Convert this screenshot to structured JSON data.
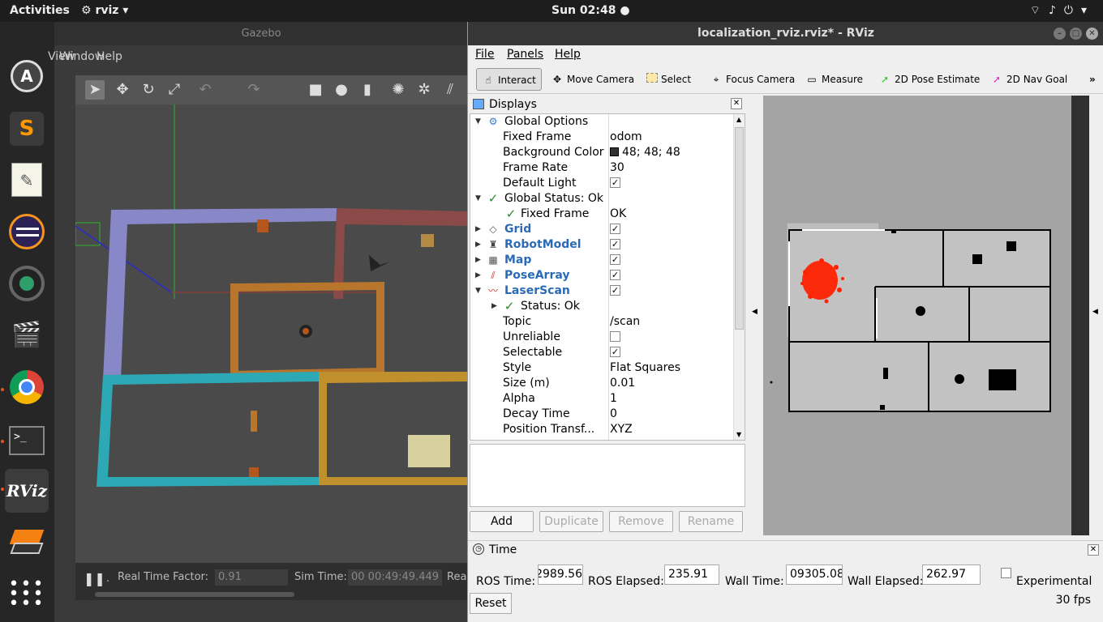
{
  "topbar": {
    "activities": "Activities",
    "app_menu": "rviz",
    "clock": "Sun 02:48"
  },
  "dock": {
    "items": [
      "ubuntu-software-icon",
      "sublime-text-icon",
      "text-editor-icon",
      "eclipse-icon",
      "camera-icon",
      "video-icon",
      "chrome-icon",
      "terminal-icon",
      "rviz-icon",
      "gazebo-icon",
      "app-grid-icon"
    ],
    "rviz_label": "RViz"
  },
  "gazebo": {
    "title": "Gazebo",
    "menu": {
      "view": "View",
      "window": "Window",
      "help": "Help"
    },
    "bottom": {
      "real_time_factor_label": "Real Time Factor:",
      "real_time_factor": "0.91",
      "sim_time_label": "Sim Time:",
      "sim_time": "00 00:49:49.449",
      "real_time_label": "Rea"
    }
  },
  "rviz": {
    "title": "localization_rviz.rviz* - RViz",
    "menu": {
      "file": "File",
      "panels": "Panels",
      "help": "Help"
    },
    "tools": {
      "interact": "Interact",
      "move_camera": "Move Camera",
      "select": "Select",
      "focus_camera": "Focus Camera",
      "measure": "Measure",
      "pose_estimate": "2D Pose Estimate",
      "nav_goal": "2D Nav Goal",
      "more": "»"
    },
    "displays": {
      "header": "Displays",
      "rows": [
        {
          "key": "Global Options",
          "value": ""
        },
        {
          "key": "Fixed Frame",
          "value": "odom"
        },
        {
          "key": "Background Color",
          "value": "48; 48; 48"
        },
        {
          "key": "Frame Rate",
          "value": "30"
        },
        {
          "key": "Default Light",
          "value": "✓"
        },
        {
          "key": "Global Status: Ok",
          "value": ""
        },
        {
          "key": "Fixed Frame",
          "value": "OK"
        },
        {
          "key": "Grid",
          "value": "✓"
        },
        {
          "key": "RobotModel",
          "value": "✓"
        },
        {
          "key": "Map",
          "value": "✓"
        },
        {
          "key": "PoseArray",
          "value": "✓"
        },
        {
          "key": "LaserScan",
          "value": "✓"
        },
        {
          "key": "Status: Ok",
          "value": ""
        },
        {
          "key": "Topic",
          "value": "/scan"
        },
        {
          "key": "Unreliable",
          "value": ""
        },
        {
          "key": "Selectable",
          "value": "✓"
        },
        {
          "key": "Style",
          "value": "Flat Squares"
        },
        {
          "key": "Size (m)",
          "value": "0.01"
        },
        {
          "key": "Alpha",
          "value": "1"
        },
        {
          "key": "Decay Time",
          "value": "0"
        },
        {
          "key": "Position Transf...",
          "value": "XYZ"
        }
      ],
      "buttons": {
        "add": "Add",
        "duplicate": "Duplicate",
        "remove": "Remove",
        "rename": "Rename"
      }
    },
    "time": {
      "header": "Time",
      "ros_time_label": "ROS Time:",
      "ros_time": "2989.56",
      "ros_elapsed_label": "ROS Elapsed:",
      "ros_elapsed": "235.91",
      "wall_time_label": "Wall Time:",
      "wall_time": "09305.08",
      "wall_elapsed_label": "Wall Elapsed:",
      "wall_elapsed": "262.97",
      "experimental_label": "Experimental",
      "reset": "Reset",
      "fps": "30 fps"
    }
  }
}
